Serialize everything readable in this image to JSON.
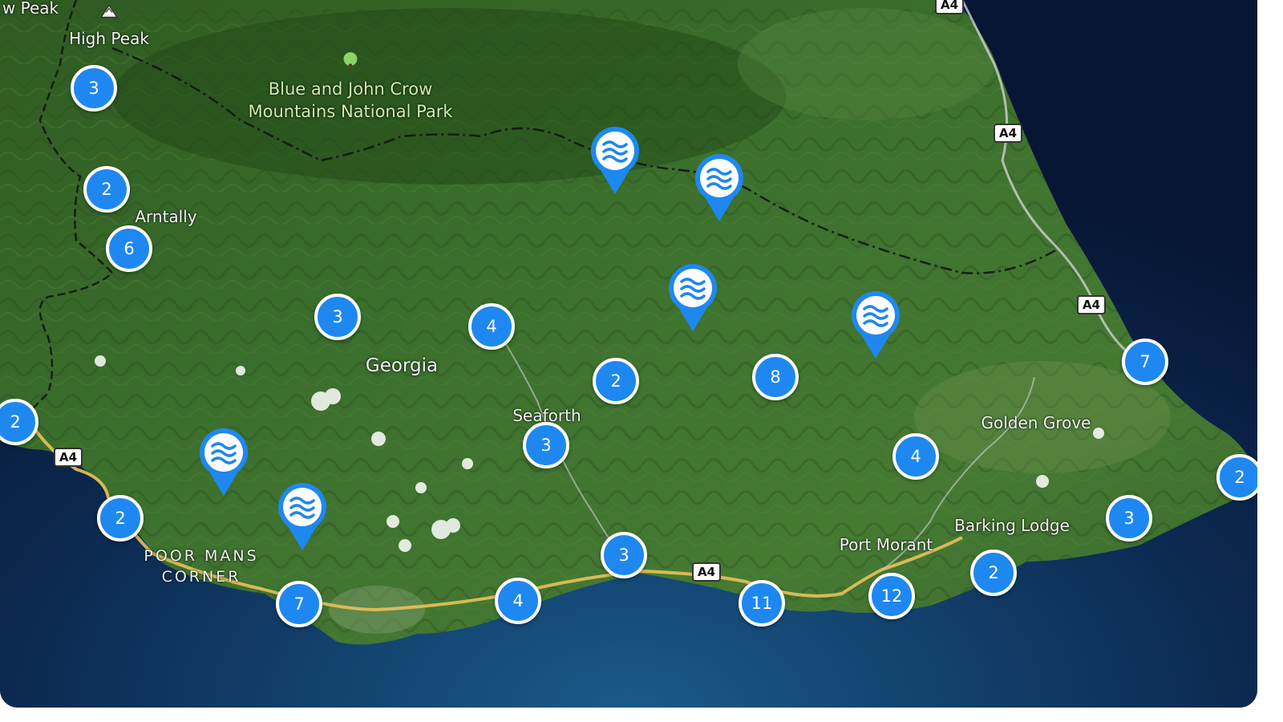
{
  "map": {
    "places": [
      {
        "name": "High Peak"
      },
      {
        "name": "w Peak"
      },
      {
        "name": "Arntally"
      },
      {
        "name": "Georgia"
      },
      {
        "name": "Seaforth"
      },
      {
        "name": "Golden Grove"
      },
      {
        "name": "Barking Lodge"
      },
      {
        "name": "Port Morant"
      }
    ],
    "park_name_line1": "Blue and John Crow",
    "park_name_line2": "Mountains National Park",
    "corner_line1": "POOR MANS",
    "corner_line2": "CORNER",
    "road_shields": [
      "A4",
      "A4",
      "A4",
      "A4",
      "A4"
    ],
    "clusters": [
      "3",
      "2",
      "6",
      "3",
      "4",
      "2",
      "8",
      "7",
      "2",
      "3",
      "4",
      "2",
      "2",
      "3",
      "3",
      "7",
      "4",
      "11",
      "12",
      "2"
    ],
    "water_pins": [
      "water-waves-icon",
      "water-waves-icon",
      "water-waves-icon",
      "water-waves-icon",
      "water-waves-icon",
      "water-waves-icon"
    ],
    "colors": {
      "cluster_fill": "#1e88f0",
      "cluster_border": "#ffffff",
      "pin_fill": "#1e88f0",
      "sea": "#0a1c3a",
      "land": "#3a6b2a",
      "road_main": "#e8c15a"
    }
  }
}
